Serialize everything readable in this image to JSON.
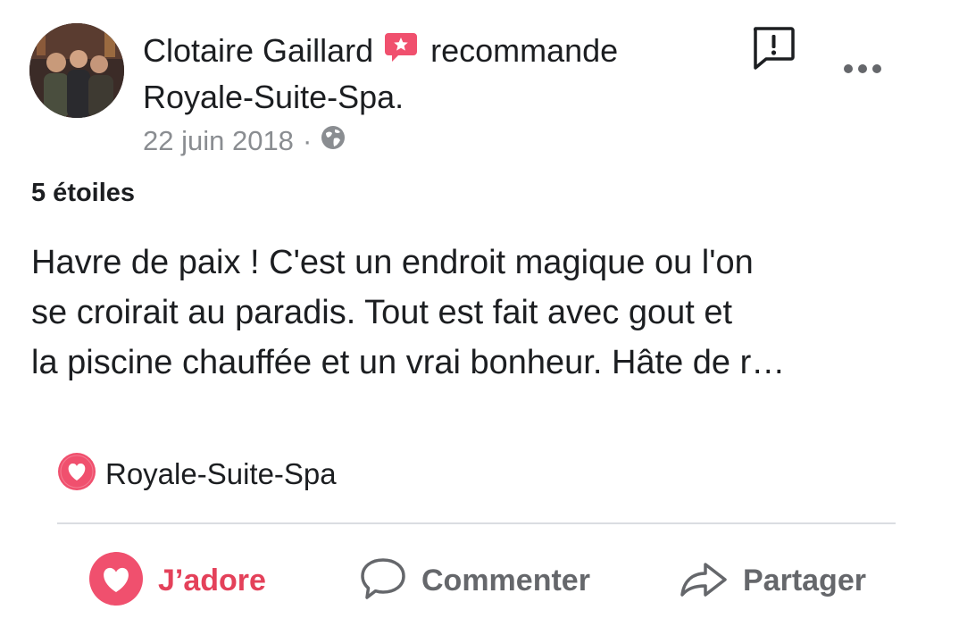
{
  "post": {
    "author": "Clotaire Gaillard",
    "verb": "recommande",
    "page": "Royale-Suite-Spa.",
    "date": "22 juin 2018",
    "separator": "·",
    "privacy_icon": "globe-icon"
  },
  "rating": "5 étoiles",
  "review_text": "Havre de paix ! C'est un endroit magique ou l'on\nse croirait au paradis. Tout  est fait avec gout et\nla piscine chauffée et un vrai bonheur. Hâte de r…",
  "page_link": {
    "label": "Royale-Suite-Spa",
    "icon": "heart-badge-icon"
  },
  "actions": {
    "like": "J’adore",
    "comment": "Commenter",
    "share": "Partager"
  },
  "colors": {
    "accent": "#e4415a",
    "text": "#1c1e21",
    "secondary": "#65676b",
    "meta": "#8a8d91",
    "divider": "#dadde1"
  }
}
